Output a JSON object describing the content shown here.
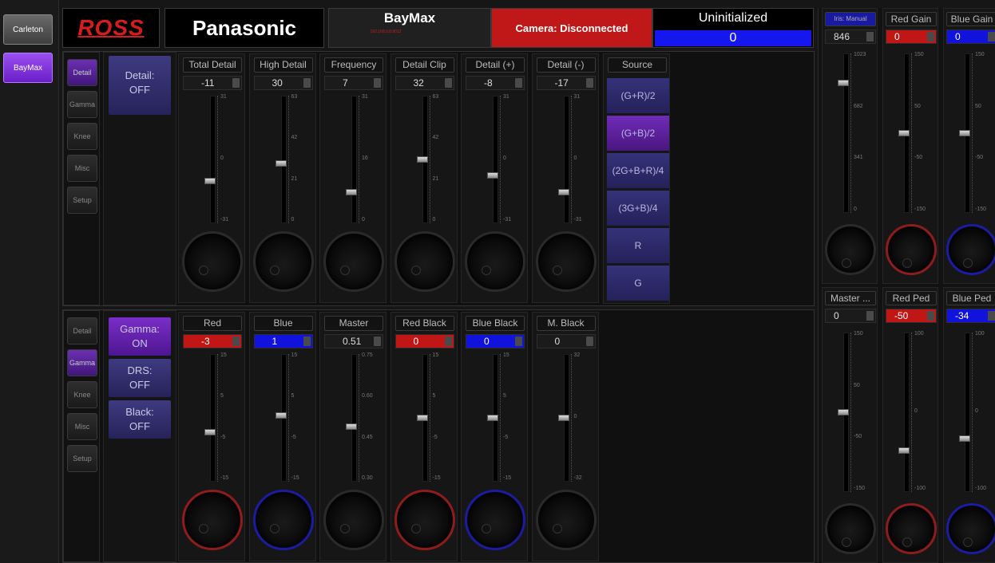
{
  "sidebar": {
    "items": [
      {
        "label": "Carleton",
        "active": false
      },
      {
        "label": "BayMax",
        "active": true
      }
    ]
  },
  "header": {
    "logo": "ROSS",
    "brand": "Panasonic",
    "camera_name": "BayMax",
    "camera_ip": "192.168.0.8:9012",
    "status": "Camera: Disconnected",
    "state_label": "Uninitialized",
    "state_value": "0"
  },
  "detail_section": {
    "tabs": [
      "Detail",
      "Gamma",
      "Knee",
      "Misc",
      "Setup"
    ],
    "active_tab": "Detail",
    "toggles": [
      {
        "label": "Detail:\nOFF"
      }
    ],
    "strips": [
      {
        "label": "Total Detail",
        "value": "-11",
        "ticks": [
          "31",
          "0",
          "-31"
        ],
        "level": 0.32,
        "ring": "none"
      },
      {
        "label": "High Detail",
        "value": "30",
        "ticks": [
          "63",
          "42",
          "21",
          "0"
        ],
        "level": 0.47,
        "ring": "none"
      },
      {
        "label": "Frequency",
        "value": "7",
        "ticks": [
          "31",
          "16",
          "0"
        ],
        "level": 0.23,
        "ring": "none"
      },
      {
        "label": "Detail Clip",
        "value": "32",
        "ticks": [
          "63",
          "42",
          "21",
          "0"
        ],
        "level": 0.5,
        "ring": "none"
      },
      {
        "label": "Detail (+)",
        "value": "-8",
        "ticks": [
          "31",
          "0",
          "-31"
        ],
        "level": 0.37,
        "ring": "none"
      },
      {
        "label": "Detail (-)",
        "value": "-17",
        "ticks": [
          "31",
          "0",
          "-31"
        ],
        "level": 0.23,
        "ring": "none"
      }
    ],
    "source": {
      "label": "Source",
      "options": [
        "(G+R)/2",
        "(G+B)/2",
        "(2G+B+R)/4",
        "(3G+B)/4",
        "R",
        "G"
      ],
      "selected": "(G+B)/2"
    }
  },
  "gamma_section": {
    "tabs": [
      "Detail",
      "Gamma",
      "Knee",
      "Misc",
      "Setup"
    ],
    "active_tab": "Gamma",
    "toggles": [
      {
        "label": "Gamma:\nON",
        "active": true
      },
      {
        "label": "DRS:\nOFF",
        "active": false
      },
      {
        "label": "Black:\nOFF",
        "active": false
      }
    ],
    "strips": [
      {
        "label": "Red",
        "value": "-3",
        "tone": "red",
        "ticks": [
          "15",
          "5",
          "-5",
          "-15"
        ],
        "level": 0.38,
        "ring": "red"
      },
      {
        "label": "Blue",
        "value": "1",
        "tone": "blue",
        "ticks": [
          "15",
          "5",
          "-5",
          "-15"
        ],
        "level": 0.52,
        "ring": "blue"
      },
      {
        "label": "Master",
        "value": "0.51",
        "tone": "none",
        "ticks": [
          "0.75",
          "0.60",
          "0.45",
          "0.30"
        ],
        "level": 0.43,
        "ring": "none"
      },
      {
        "label": "Red Black",
        "value": "0",
        "tone": "red",
        "ticks": [
          "15",
          "5",
          "-5",
          "-15"
        ],
        "level": 0.5,
        "ring": "red"
      },
      {
        "label": "Blue Black",
        "value": "0",
        "tone": "blue",
        "ticks": [
          "15",
          "5",
          "-5",
          "-15"
        ],
        "level": 0.5,
        "ring": "blue"
      },
      {
        "label": "M. Black",
        "value": "0",
        "tone": "none",
        "ticks": [
          "32",
          "0",
          "-32"
        ],
        "level": 0.5,
        "ring": "none"
      }
    ]
  },
  "right_top": [
    {
      "label": "Iris: Manual",
      "value": "846",
      "tone": "none",
      "ticks": [
        "1023",
        "682",
        "341",
        "0"
      ],
      "level": 0.83,
      "ring": "none"
    },
    {
      "label": "Red Gain",
      "value": "0",
      "tone": "red",
      "ticks": [
        "150",
        "50",
        "-50",
        "-150"
      ],
      "level": 0.5,
      "ring": "red"
    },
    {
      "label": "Blue Gain",
      "value": "0",
      "tone": "blue",
      "ticks": [
        "150",
        "50",
        "-50",
        "-150"
      ],
      "level": 0.5,
      "ring": "blue"
    }
  ],
  "right_bottom": [
    {
      "label": "Master ...",
      "value": "0",
      "tone": "none",
      "ticks": [
        "150",
        "50",
        "-50",
        "-150"
      ],
      "level": 0.5,
      "ring": "none"
    },
    {
      "label": "Red Ped",
      "value": "-50",
      "tone": "red",
      "ticks": [
        "100",
        "0",
        "-100"
      ],
      "level": 0.25,
      "ring": "red"
    },
    {
      "label": "Blue Ped",
      "value": "-34",
      "tone": "blue",
      "ticks": [
        "100",
        "0",
        "-100"
      ],
      "level": 0.33,
      "ring": "blue"
    }
  ]
}
